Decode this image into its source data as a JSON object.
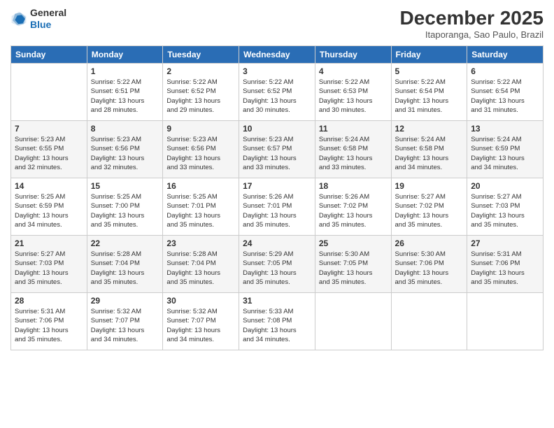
{
  "header": {
    "logo": {
      "line1": "General",
      "line2": "Blue"
    },
    "title": "December 2025",
    "location": "Itaporanga, Sao Paulo, Brazil"
  },
  "days_of_week": [
    "Sunday",
    "Monday",
    "Tuesday",
    "Wednesday",
    "Thursday",
    "Friday",
    "Saturday"
  ],
  "weeks": [
    [
      {
        "day": "",
        "info": ""
      },
      {
        "day": "1",
        "info": "Sunrise: 5:22 AM\nSunset: 6:51 PM\nDaylight: 13 hours\nand 28 minutes."
      },
      {
        "day": "2",
        "info": "Sunrise: 5:22 AM\nSunset: 6:52 PM\nDaylight: 13 hours\nand 29 minutes."
      },
      {
        "day": "3",
        "info": "Sunrise: 5:22 AM\nSunset: 6:52 PM\nDaylight: 13 hours\nand 30 minutes."
      },
      {
        "day": "4",
        "info": "Sunrise: 5:22 AM\nSunset: 6:53 PM\nDaylight: 13 hours\nand 30 minutes."
      },
      {
        "day": "5",
        "info": "Sunrise: 5:22 AM\nSunset: 6:54 PM\nDaylight: 13 hours\nand 31 minutes."
      },
      {
        "day": "6",
        "info": "Sunrise: 5:22 AM\nSunset: 6:54 PM\nDaylight: 13 hours\nand 31 minutes."
      }
    ],
    [
      {
        "day": "7",
        "info": "Sunrise: 5:23 AM\nSunset: 6:55 PM\nDaylight: 13 hours\nand 32 minutes."
      },
      {
        "day": "8",
        "info": "Sunrise: 5:23 AM\nSunset: 6:56 PM\nDaylight: 13 hours\nand 32 minutes."
      },
      {
        "day": "9",
        "info": "Sunrise: 5:23 AM\nSunset: 6:56 PM\nDaylight: 13 hours\nand 33 minutes."
      },
      {
        "day": "10",
        "info": "Sunrise: 5:23 AM\nSunset: 6:57 PM\nDaylight: 13 hours\nand 33 minutes."
      },
      {
        "day": "11",
        "info": "Sunrise: 5:24 AM\nSunset: 6:58 PM\nDaylight: 13 hours\nand 33 minutes."
      },
      {
        "day": "12",
        "info": "Sunrise: 5:24 AM\nSunset: 6:58 PM\nDaylight: 13 hours\nand 34 minutes."
      },
      {
        "day": "13",
        "info": "Sunrise: 5:24 AM\nSunset: 6:59 PM\nDaylight: 13 hours\nand 34 minutes."
      }
    ],
    [
      {
        "day": "14",
        "info": "Sunrise: 5:25 AM\nSunset: 6:59 PM\nDaylight: 13 hours\nand 34 minutes."
      },
      {
        "day": "15",
        "info": "Sunrise: 5:25 AM\nSunset: 7:00 PM\nDaylight: 13 hours\nand 35 minutes."
      },
      {
        "day": "16",
        "info": "Sunrise: 5:25 AM\nSunset: 7:01 PM\nDaylight: 13 hours\nand 35 minutes."
      },
      {
        "day": "17",
        "info": "Sunrise: 5:26 AM\nSunset: 7:01 PM\nDaylight: 13 hours\nand 35 minutes."
      },
      {
        "day": "18",
        "info": "Sunrise: 5:26 AM\nSunset: 7:02 PM\nDaylight: 13 hours\nand 35 minutes."
      },
      {
        "day": "19",
        "info": "Sunrise: 5:27 AM\nSunset: 7:02 PM\nDaylight: 13 hours\nand 35 minutes."
      },
      {
        "day": "20",
        "info": "Sunrise: 5:27 AM\nSunset: 7:03 PM\nDaylight: 13 hours\nand 35 minutes."
      }
    ],
    [
      {
        "day": "21",
        "info": "Sunrise: 5:27 AM\nSunset: 7:03 PM\nDaylight: 13 hours\nand 35 minutes."
      },
      {
        "day": "22",
        "info": "Sunrise: 5:28 AM\nSunset: 7:04 PM\nDaylight: 13 hours\nand 35 minutes."
      },
      {
        "day": "23",
        "info": "Sunrise: 5:28 AM\nSunset: 7:04 PM\nDaylight: 13 hours\nand 35 minutes."
      },
      {
        "day": "24",
        "info": "Sunrise: 5:29 AM\nSunset: 7:05 PM\nDaylight: 13 hours\nand 35 minutes."
      },
      {
        "day": "25",
        "info": "Sunrise: 5:30 AM\nSunset: 7:05 PM\nDaylight: 13 hours\nand 35 minutes."
      },
      {
        "day": "26",
        "info": "Sunrise: 5:30 AM\nSunset: 7:06 PM\nDaylight: 13 hours\nand 35 minutes."
      },
      {
        "day": "27",
        "info": "Sunrise: 5:31 AM\nSunset: 7:06 PM\nDaylight: 13 hours\nand 35 minutes."
      }
    ],
    [
      {
        "day": "28",
        "info": "Sunrise: 5:31 AM\nSunset: 7:06 PM\nDaylight: 13 hours\nand 35 minutes."
      },
      {
        "day": "29",
        "info": "Sunrise: 5:32 AM\nSunset: 7:07 PM\nDaylight: 13 hours\nand 34 minutes."
      },
      {
        "day": "30",
        "info": "Sunrise: 5:32 AM\nSunset: 7:07 PM\nDaylight: 13 hours\nand 34 minutes."
      },
      {
        "day": "31",
        "info": "Sunrise: 5:33 AM\nSunset: 7:08 PM\nDaylight: 13 hours\nand 34 minutes."
      },
      {
        "day": "",
        "info": ""
      },
      {
        "day": "",
        "info": ""
      },
      {
        "day": "",
        "info": ""
      }
    ]
  ]
}
